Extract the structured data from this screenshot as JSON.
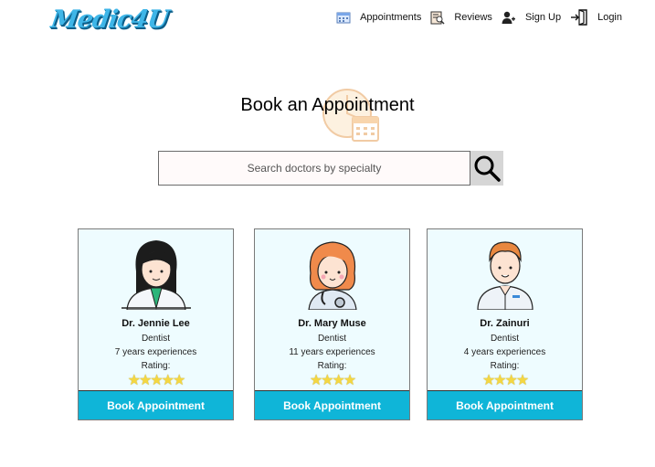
{
  "brand": {
    "logo_text": "Medic4U"
  },
  "nav": [
    {
      "label": "Appointments",
      "icon": "calendar-icon"
    },
    {
      "label": "Reviews",
      "icon": "review-document-icon"
    },
    {
      "label": "Sign Up",
      "icon": "user-add-icon"
    },
    {
      "label": "Login",
      "icon": "login-door-icon"
    }
  ],
  "hero": {
    "title": "Book an Appointment"
  },
  "search": {
    "placeholder": "Search doctors by specialty",
    "value": ""
  },
  "doctors": [
    {
      "name": "Dr. Jennie Lee",
      "specialty": "Dentist",
      "experience": "7 years experiences",
      "rating_label": "Rating:",
      "stars": "★★★★★",
      "rating": 5,
      "button": "Book Appointment"
    },
    {
      "name": "Dr. Mary Muse",
      "specialty": "Dentist",
      "experience": "11 years experiences",
      "rating_label": "Rating:",
      "stars": "★★★★",
      "rating": 4,
      "button": "Book Appointment"
    },
    {
      "name": "Dr. Zainuri",
      "specialty": "Dentist",
      "experience": "4 years experiences",
      "rating_label": "Rating:",
      "stars": "★★★★",
      "rating": 4,
      "button": "Book Appointment"
    }
  ],
  "colors": {
    "accent": "#0fb5d8",
    "card_bg": "#eefcff",
    "star": "#f4d742"
  }
}
